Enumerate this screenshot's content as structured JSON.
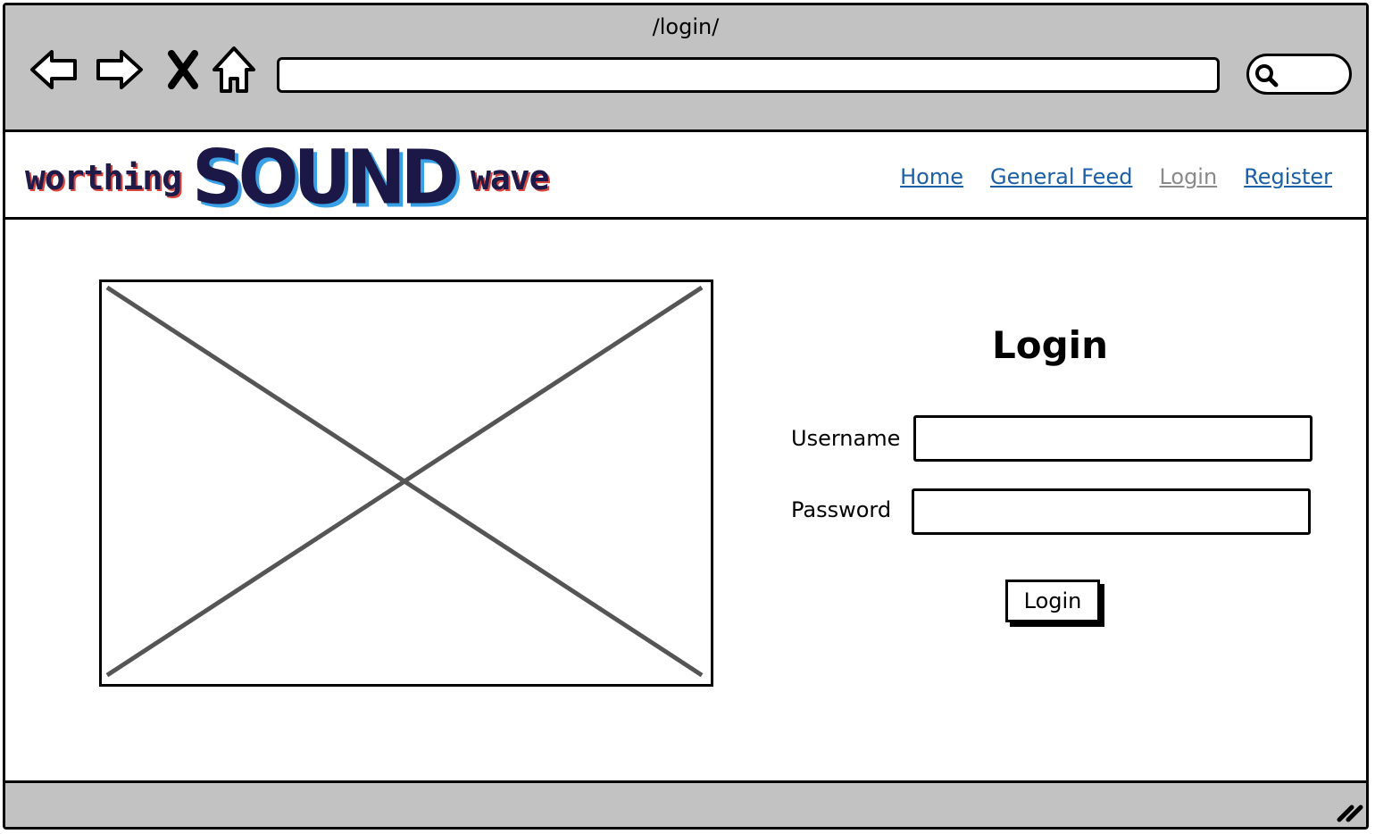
{
  "browser": {
    "title": "/login/",
    "address_value": "",
    "search_value": "",
    "icons": [
      "back-icon",
      "forward-icon",
      "close-icon",
      "home-icon",
      "search-icon",
      "resize-grip-icon"
    ]
  },
  "site": {
    "logo": {
      "left": "worthing",
      "center": "SOUND",
      "right": "wave"
    },
    "nav": {
      "home": "Home",
      "general_feed": "General Feed",
      "login": "Login",
      "register": "Register"
    },
    "colors": {
      "link": "#1b5fa7",
      "active_link": "#8a8a8a",
      "logo_main": "#1b1747",
      "logo_shadow_blue": "#3aa0e6",
      "logo_shadow_red": "#d9463e",
      "chrome": "#c2c2c2"
    }
  },
  "login_form": {
    "title": "Login",
    "username_label": "Username",
    "username_value": "",
    "password_label": "Password",
    "password_value": "",
    "submit_label": "Login"
  },
  "image_placeholder": {
    "icon": "image-placeholder-icon"
  }
}
